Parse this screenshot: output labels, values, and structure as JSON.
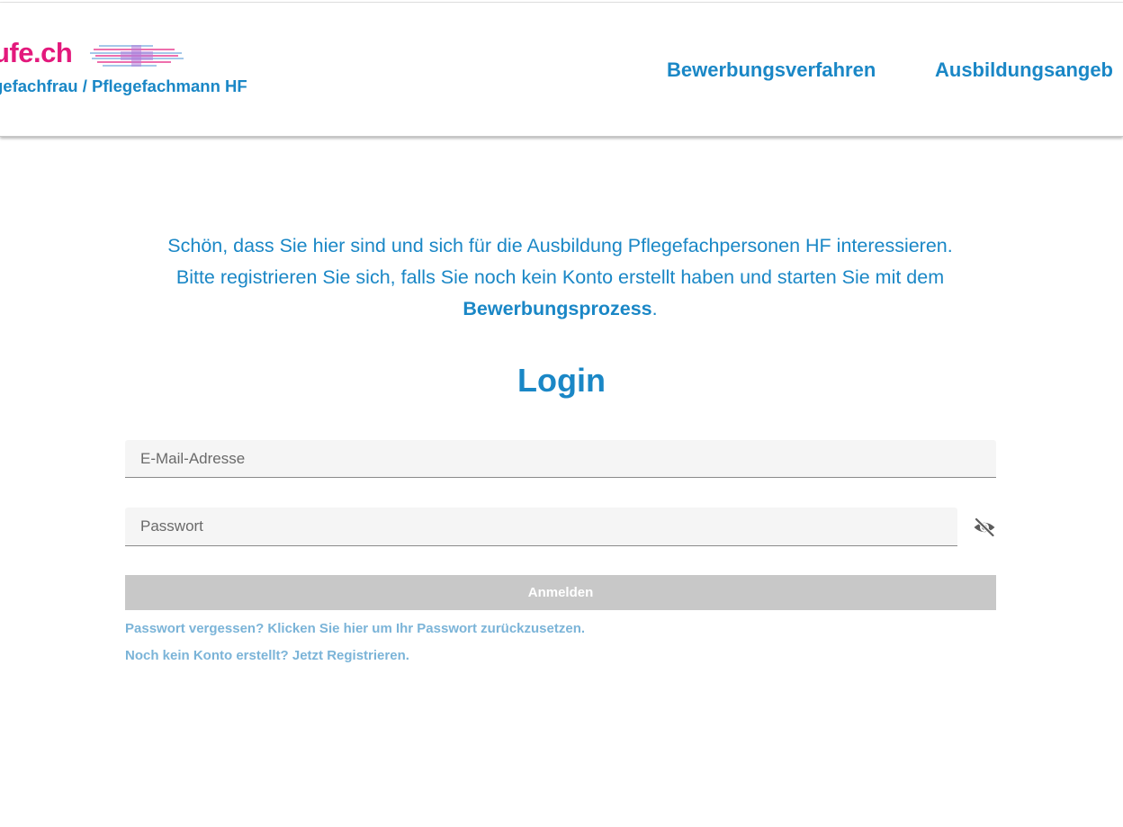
{
  "header": {
    "logo_text": "ufe.ch",
    "subtitle": "gefachfrau / Pflegefachmann HF",
    "nav": [
      {
        "label": "Bewerbungsverfahren"
      },
      {
        "label": "Ausbildungsangeb"
      }
    ]
  },
  "intro": {
    "line1": "Schön, dass Sie hier sind und sich für die Ausbildung Pflegefachpersonen HF interessieren.",
    "line2": "Bitte registrieren Sie sich, falls Sie noch kein Konto erstellt haben und starten Sie mit dem",
    "emphasis": "Bewerbungsprozess",
    "end": "."
  },
  "login": {
    "title": "Login",
    "email_placeholder": "E-Mail-Adresse",
    "password_placeholder": "Passwort",
    "submit_label": "Anmelden",
    "forgot_password": "Passwort vergessen? Klicken Sie hier um Ihr Passwort zurückzusetzen.",
    "register": "Noch kein Konto erstellt? Jetzt Registrieren."
  },
  "icons": {
    "password_toggle": "eye-off-icon",
    "logo": "cross-lines-logo"
  },
  "colors": {
    "brand_blue": "#1a87c6",
    "brand_magenta": "#e3197c",
    "link_light_blue": "#7bb4d8",
    "button_disabled": "#c8c8c8",
    "field_background": "#f5f5f5"
  }
}
